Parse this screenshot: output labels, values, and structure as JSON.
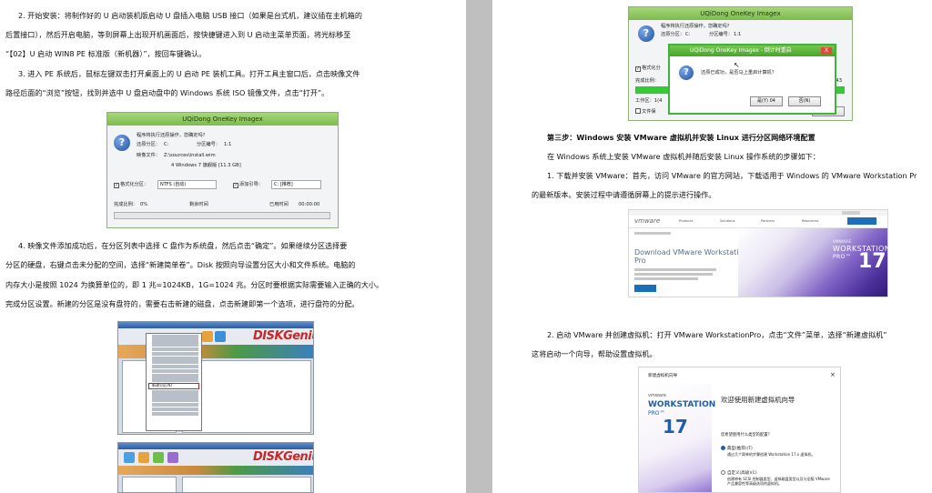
{
  "left_page": {
    "para1_line1": "2. 开始安装：将制作好的 U 启动装机版启动 U 盘插入电脑 USB 接口（如果是台式机，建议插在主机箱的",
    "para1_line2": "后置接口），然后开启电脑，等到屏幕上出现开机画面后，按快捷键进入到 U 启动主菜单页面，将光标移至",
    "para1_line3": "“【02】U 启动 WIN8 PE 标准版（新机器）”，按回车键确认。",
    "para2_line1": "3. 进入 PE 系统后，鼠标左键双击打开桌面上的 U 启动 PE 装机工具。打开工具主窗口后，点击映像文件",
    "para2_line2": "路径后面的“浏览”按钮，找到并选中 U 盘启动盘中的 Windows 系统 ISO 镜像文件，点击“打开”。",
    "para3_line1": "4. 映像文件添加成功后，在分区列表中选择 C 盘作为系统盘，然后点击“确定”。如果继续分区选择要",
    "para3_line2": "分区的硬盘，右键点击未分配的空间，选择“新建简单卷”。Disk 按照向导设置分区大小和文件系统。电脑的",
    "para3_line3": "内存大小是按照 1024 为换算单位的，即 1 兆=1024KB，1G=1024 兆。分区时要根据实际需要输入正确的大小。",
    "para3_line4": "完成分区设置。新建的分区是没有盘符的，需要右击新建的磁盘，点击新建即第一个选项，进行盘符的分配。",
    "imagex_dialog": {
      "title": "UQiDong OneKey Imagex",
      "prompt": "程序将执行还原操作，您确定吗？",
      "restore_label": "还原分区：",
      "restore_value": "C:",
      "partition_label": "分区编号：",
      "partition_value": "1:1",
      "image_label": "映像文件：",
      "image_value": "Z:\\sources\\install.wim",
      "edition": "4 Windows 7 旗舰版 [11.3 GB]",
      "format_label": "格式化分区：",
      "format_value": "NTFS (自动)",
      "boot_label": "添加引导：",
      "boot_value": "C: [推荐]",
      "progress_label": "完成比例：",
      "progress_value": "0%",
      "progress_fraction": 0,
      "remaining_label": "剩余时间",
      "elapsed_label": "已用时间",
      "elapsed_value": "00:00:00"
    },
    "diskgenius_logo": "DISKGenius",
    "diskgenius_logo_2": "DISKGenius",
    "diskgenius_menu_highlight": "新建分区(N)"
  },
  "right_page": {
    "top_dialog": {
      "title": "UQiDong OneKey Imagex",
      "prompt": "程序将执行还原操作，您确定吗？",
      "restore_label": "还原分区：",
      "restore_value": "C:",
      "partition_label": "分区编号：",
      "partition_value": "1:1",
      "format_label": "格式化分",
      "progress_label": "完成比例：",
      "time_fragment": "0:17:43",
      "work_label": "工作区：",
      "work_value": "1(4",
      "file_label": "文件保",
      "inner_title": "UQiDong OneKey Imagex - 倒计时重启",
      "inner_close": "X",
      "inner_message": "还原已成功，是否马上重启计算机？",
      "yes_button": "是(Y) 04",
      "no_button": "否(N)",
      "confirm_button": "确定(O)"
    },
    "step3_heading": "第三步：Windows 安装 VMware 虚拟机并安装 Linux 进行分区网络环境配置",
    "step3_intro": "在 Windows 系统上安装 VMware 虚拟机并随后安装 Linux 操作系统的步骤如下：",
    "step1_line1": "1. 下载并安装 VMware：首先，访问 VMware 的官方网站，下载适用于 Windows 的 VMware Workstation Pr",
    "step1_line2": "的最新版本。安装过程中请遵循屏幕上的提示进行操作。",
    "vmware_site": {
      "logo": "vmware",
      "nav": [
        "Products",
        "Solutions",
        "Partners",
        "Resources",
        "Support"
      ],
      "heading_line1": "Download VMware Workstation",
      "heading_line2": "Pro",
      "banner_brand": "VMWARE",
      "banner_product": "WORKSTATION",
      "banner_edition": "PRO™",
      "banner_version": "17"
    },
    "step2_line1": "2. 启动 VMware 并创建虚拟机：打开 VMware WorkstationPro，点击“文件”菜单，选择“新建虚拟机”",
    "step2_line2": "这将启动一个向导，帮助设置虚拟机。",
    "wizard": {
      "title": "新建虚拟机向导",
      "close": "×",
      "brand": "vmware",
      "product": "WORKSTATION",
      "edition": "PRO™",
      "version": "17",
      "heading": "欢迎使用新建虚拟机向导",
      "question": "您希望使用什么类型的配置？",
      "option1_label": "典型(推荐)(T)",
      "option1_desc": "通过几个简单的步骤创建 Workstation 17.x 虚拟机。",
      "option2_label": "自定义(高级)(C)",
      "option2_desc": "创建带有 SCSI 控制器类型、虚拟磁盘类型以及与旧版 VMware 产品兼容性等高级选项的虚拟机。"
    }
  }
}
